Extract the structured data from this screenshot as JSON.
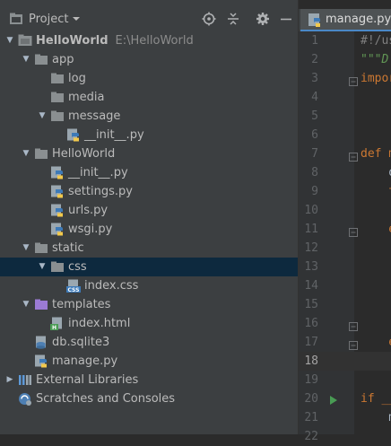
{
  "panel": {
    "title": "Project"
  },
  "tree": [
    {
      "label": "HelloWorld",
      "sub": "E:\\HelloWorld",
      "icon": "project-folder-icon",
      "expanded": true,
      "level": 0,
      "bold": true
    },
    {
      "label": "app",
      "icon": "folder-icon",
      "expanded": true,
      "level": 1
    },
    {
      "label": "log",
      "icon": "folder-icon",
      "level": 2
    },
    {
      "label": "media",
      "icon": "folder-icon",
      "level": 2
    },
    {
      "label": "message",
      "icon": "folder-icon",
      "expanded": true,
      "level": 2
    },
    {
      "label": "__init__.py",
      "icon": "python-file-icon",
      "level": 3
    },
    {
      "label": "HelloWorld",
      "icon": "folder-icon",
      "expanded": true,
      "level": 1
    },
    {
      "label": "__init__.py",
      "icon": "python-file-icon",
      "level": 2
    },
    {
      "label": "settings.py",
      "icon": "python-file-icon",
      "level": 2
    },
    {
      "label": "urls.py",
      "icon": "python-file-icon",
      "level": 2
    },
    {
      "label": "wsgi.py",
      "icon": "python-file-icon",
      "level": 2
    },
    {
      "label": "static",
      "icon": "folder-icon",
      "expanded": true,
      "level": 1
    },
    {
      "label": "css",
      "icon": "folder-icon",
      "expanded": true,
      "level": 2,
      "selected": true
    },
    {
      "label": "index.css",
      "icon": "css-file-icon",
      "level": 3
    },
    {
      "label": "templates",
      "icon": "templates-folder-icon",
      "expanded": true,
      "level": 1
    },
    {
      "label": "index.html",
      "icon": "html-file-icon",
      "level": 2
    },
    {
      "label": "db.sqlite3",
      "icon": "database-file-icon",
      "level": 1
    },
    {
      "label": "manage.py",
      "icon": "python-file-icon",
      "level": 1
    },
    {
      "label": "External Libraries",
      "icon": "external-libraries-icon",
      "collapsed": true,
      "level": 0
    },
    {
      "label": "Scratches and Consoles",
      "icon": "scratches-icon",
      "level": 0
    }
  ],
  "editor": {
    "tab_label": "manage.py",
    "current_line": 18,
    "lines": [
      {
        "n": "1",
        "code": "#!/us",
        "cls": "cm"
      },
      {
        "n": "2",
        "code": "\"\"\"D",
        "cls": "doc"
      },
      {
        "n": "3",
        "code": "impor",
        "cls": "kw",
        "fold": true
      },
      {
        "n": "4",
        "code": "",
        "cls": "txt"
      },
      {
        "n": "5",
        "code": "",
        "cls": "txt"
      },
      {
        "n": "6",
        "code": "",
        "cls": "txt"
      },
      {
        "n": "7",
        "code": "def m",
        "cls": "kw",
        "fold": true
      },
      {
        "n": "8",
        "code": "    o",
        "cls": "txt"
      },
      {
        "n": "9",
        "code": "    t",
        "cls": "kw"
      },
      {
        "n": "10",
        "code": "",
        "cls": "txt"
      },
      {
        "n": "11",
        "code": "    e",
        "cls": "kw",
        "fold": true
      },
      {
        "n": "12",
        "code": "",
        "cls": "txt"
      },
      {
        "n": "13",
        "code": "",
        "cls": "txt"
      },
      {
        "n": "14",
        "code": "",
        "cls": "txt"
      },
      {
        "n": "15",
        "code": "",
        "cls": "txt"
      },
      {
        "n": "16",
        "code": "",
        "cls": "txt",
        "fold": true
      },
      {
        "n": "17",
        "code": "    e",
        "cls": "kw",
        "fold": true
      },
      {
        "n": "18",
        "code": "",
        "cls": "txt"
      },
      {
        "n": "19",
        "code": "",
        "cls": "txt"
      },
      {
        "n": "20",
        "code": "if __",
        "cls": "kw",
        "run": true
      },
      {
        "n": "21",
        "code": "    m",
        "cls": "txt"
      },
      {
        "n": "22",
        "code": "",
        "cls": "txt"
      }
    ]
  },
  "colors": {
    "panel_bg": "#3c3f41",
    "selection": "#0d293e",
    "editor_bg": "#2b2b2b",
    "folder": "#8a8f91",
    "python_blue": "#3d7ab8",
    "python_yellow": "#f2c94c",
    "keyword": "#cc7832",
    "run_green": "#499c54"
  }
}
